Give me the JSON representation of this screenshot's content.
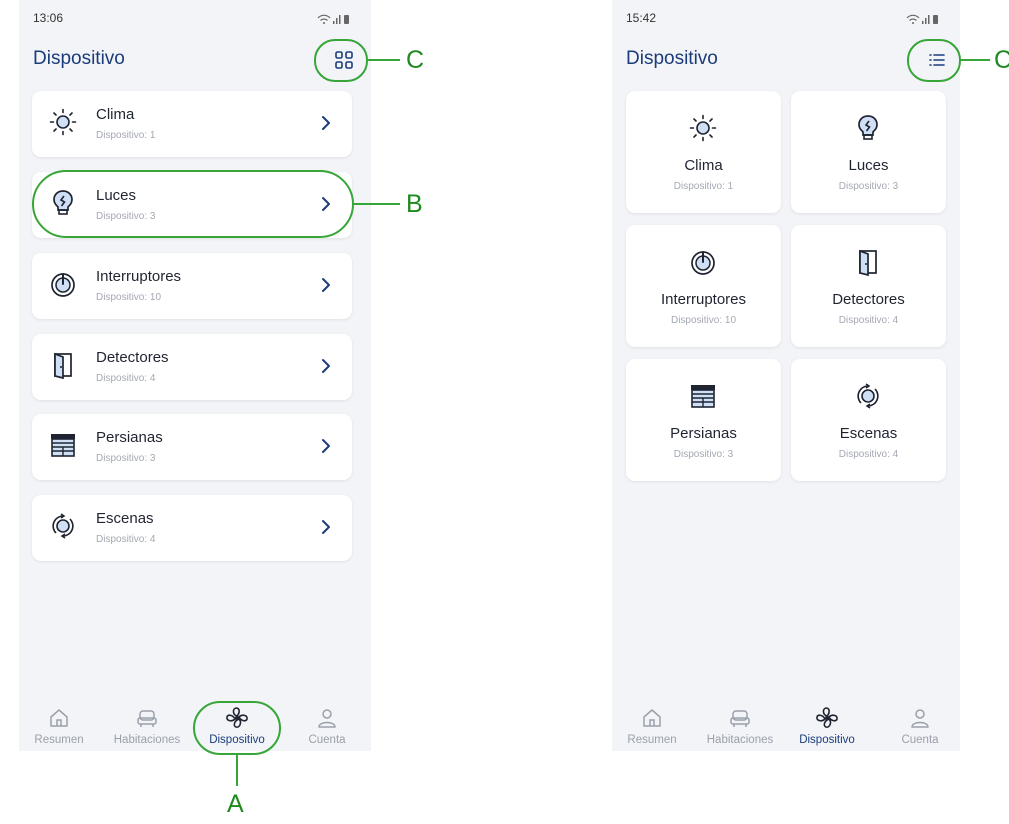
{
  "left_phone": {
    "status_time": "13:06",
    "title": "Dispositivo",
    "devices": [
      {
        "name": "Clima",
        "count": "Dispositivo: 1",
        "icon": "sun-icon"
      },
      {
        "name": "Luces",
        "count": "Dispositivo: 3",
        "icon": "lightbulb-icon"
      },
      {
        "name": "Interruptores",
        "count": "Dispositivo: 10",
        "icon": "power-icon"
      },
      {
        "name": "Detectores",
        "count": "Dispositivo: 4",
        "icon": "door-icon"
      },
      {
        "name": "Persianas",
        "count": "Dispositivo: 3",
        "icon": "blinds-icon"
      },
      {
        "name": "Escenas",
        "count": "Dispositivo: 4",
        "icon": "scene-cycle-icon"
      }
    ],
    "nav": [
      {
        "label": "Resumen",
        "icon": "home-icon"
      },
      {
        "label": "Habitaciones",
        "icon": "sofa-icon"
      },
      {
        "label": "Dispositivo",
        "icon": "fan-icon"
      },
      {
        "label": "Cuenta",
        "icon": "person-icon"
      }
    ]
  },
  "right_phone": {
    "status_time": "15:42",
    "title": "Dispositivo",
    "devices": [
      {
        "name": "Clima",
        "count": "Dispositivo: 1",
        "icon": "sun-icon"
      },
      {
        "name": "Luces",
        "count": "Dispositivo: 3",
        "icon": "lightbulb-icon"
      },
      {
        "name": "Interruptores",
        "count": "Dispositivo: 10",
        "icon": "power-icon"
      },
      {
        "name": "Detectores",
        "count": "Dispositivo: 4",
        "icon": "door-icon"
      },
      {
        "name": "Persianas",
        "count": "Dispositivo: 3",
        "icon": "blinds-icon"
      },
      {
        "name": "Escenas",
        "count": "Dispositivo: 4",
        "icon": "scene-cycle-icon"
      }
    ],
    "nav": [
      {
        "label": "Resumen",
        "icon": "home-icon"
      },
      {
        "label": "Habitaciones",
        "icon": "sofa-icon"
      },
      {
        "label": "Dispositivo",
        "icon": "fan-icon"
      },
      {
        "label": "Cuenta",
        "icon": "person-icon"
      }
    ]
  },
  "annotations": {
    "a": "A",
    "b": "B",
    "c": "C",
    "c_right": "C"
  },
  "colors": {
    "accent": "#1b3c7a",
    "annotation": "#37a537",
    "background": "#f3f4f8",
    "muted": "#a4a8b3"
  }
}
